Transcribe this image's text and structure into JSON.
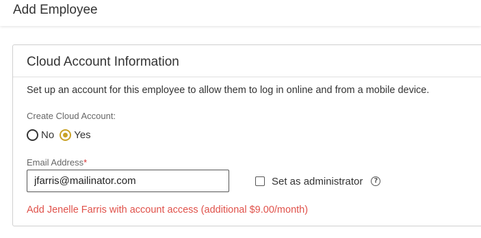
{
  "header": {
    "title": "Add Employee"
  },
  "cloud_account": {
    "title": "Cloud Account Information",
    "description": "Set up an account for this employee to allow them to log in online and from a mobile device.",
    "create_label": "Create Cloud Account:",
    "options": [
      {
        "label": "No",
        "selected": false
      },
      {
        "label": "Yes",
        "selected": true
      }
    ],
    "email_label": "Email Address",
    "email_required_mark": "*",
    "email_value": "jfarris@mailinator.com",
    "admin_label": "Set as administrator",
    "admin_checked": false,
    "help_glyph": "?",
    "notice": "Add Jenelle Farris with account access (additional $9.00/month)"
  },
  "colors": {
    "accent": "#c9a227",
    "notice": "#e0514a",
    "required": "#d32f2f"
  },
  "icons": {
    "help": "question-circle-icon"
  }
}
